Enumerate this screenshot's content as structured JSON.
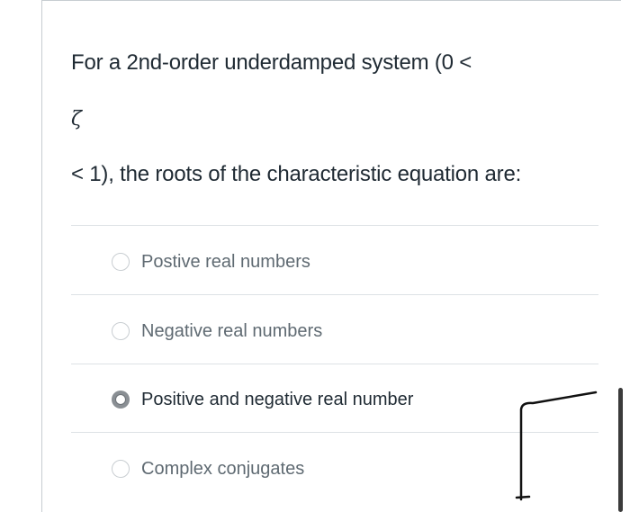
{
  "question": {
    "line1": "For a 2nd-order  underdamped system (0 <",
    "line2": "ζ",
    "line3": "< 1), the roots of the characteristic equation are:"
  },
  "options": [
    {
      "label": "Postive real numbers",
      "selected": false
    },
    {
      "label": "Negative real numbers",
      "selected": false
    },
    {
      "label": "Positive and negative real number",
      "selected": true
    },
    {
      "label": "Complex conjugates",
      "selected": false
    }
  ],
  "colors": {
    "text": "#1f2a33",
    "muted_text": "#5f6a72",
    "divider": "#dde2e5",
    "radio_checked": "#8a8f94"
  }
}
